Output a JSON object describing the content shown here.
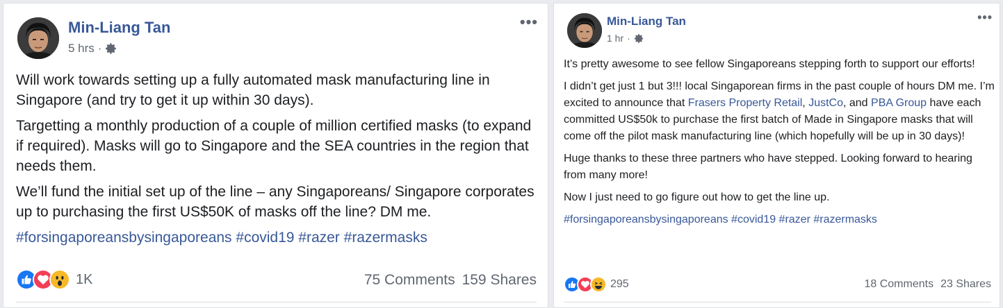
{
  "posts": [
    {
      "author": "Min-Liang Tan",
      "time": "5 hrs",
      "separator": "·",
      "more": "•••",
      "paragraphs": [
        "Will work towards setting up a fully automated mask manufacturing line in Singapore (and try to get it up within 30 days).",
        "Targetting a monthly production of a couple of million certified masks (to expand if required). Masks will go to Singapore and the SEA countries in the region that needs them.",
        "We’ll fund the initial set up of the line – any Singaporeans/ Singapore corporates up to purchasing the first US$50K of masks off the line? DM me."
      ],
      "hashtags": "#forsingaporeansbysingaporeans #covid19 #razer #razermasks",
      "reactions": [
        "like",
        "love",
        "wow"
      ],
      "reaction_count": "1K",
      "comments": "75 Comments",
      "shares": "159 Shares"
    },
    {
      "author": "Min-Liang Tan",
      "time": "1 hr",
      "separator": "·",
      "more": "•••",
      "p1": "It’s pretty awesome to see fellow Singaporeans stepping forth to support our efforts!",
      "p2_a": "I didn’t get just 1 but 3!!! local Singaporean firms in the past couple of hours DM me. I’m excited to announce that ",
      "p2_link1": "Frasers Property Retail",
      "p2_b": ", ",
      "p2_link2": "JustCo",
      "p2_c": ", and ",
      "p2_link3": "PBA Group",
      "p2_d": " have each committed US$50k to purchase the first batch of Made in Singapore masks that will come off the pilot mask manufacturing line (which hopefully will be up in 30 days)!",
      "p3": "Huge thanks to these three partners who have stepped. Looking forward to hearing from many more!",
      "p4": "Now I just need to go figure out how to get the line up.",
      "hashtags": "#forsingaporeansbysingaporeans #covid19 #razer #razermasks",
      "reactions": [
        "like",
        "love",
        "haha"
      ],
      "reaction_count": "295",
      "comments": "18 Comments",
      "shares": "23 Shares"
    }
  ],
  "icons": {
    "like_color": "#1877f2",
    "love_color": "#f33e58",
    "wow_color": "#f7b928",
    "link_color": "#385898"
  }
}
